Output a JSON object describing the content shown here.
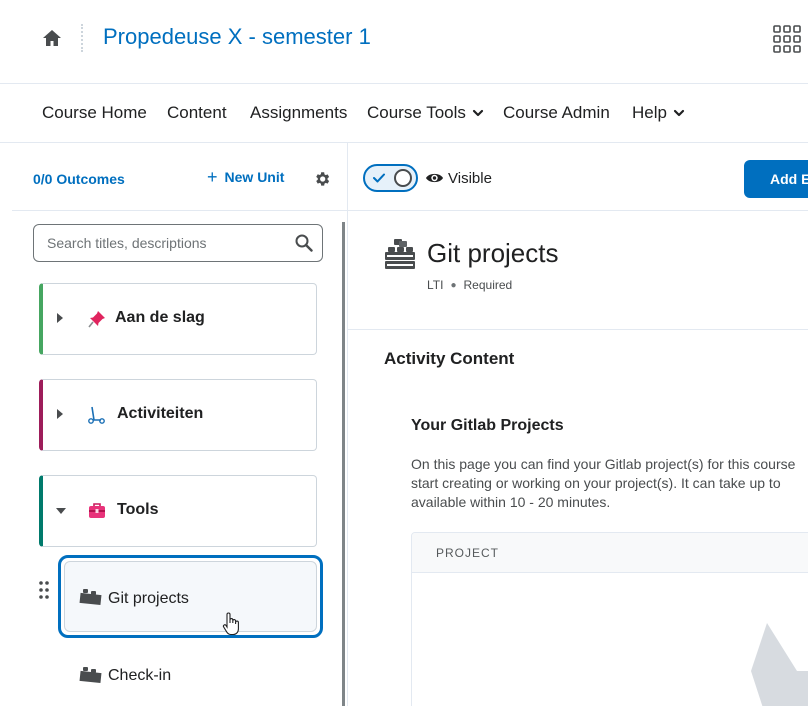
{
  "header": {
    "course_title": "Propedeuse X - semester 1",
    "icons": [
      "home-icon",
      "waffle-icon"
    ]
  },
  "nav": {
    "items": [
      {
        "label": "Course Home",
        "has_menu": false
      },
      {
        "label": "Content",
        "has_menu": false
      },
      {
        "label": "Assignments",
        "has_menu": false
      },
      {
        "label": "Course Tools",
        "has_menu": true
      },
      {
        "label": "Course Admin",
        "has_menu": false
      },
      {
        "label": "Help",
        "has_menu": true
      }
    ]
  },
  "sidebar": {
    "outcomes_link": "0/0 Outcomes",
    "new_unit_label": "New Unit",
    "search_placeholder": "Search titles, descriptions",
    "units": [
      {
        "label": "Aan de slag",
        "icon": "pin-icon",
        "accent": "#46a661",
        "expanded": false
      },
      {
        "label": "Activiteiten",
        "icon": "scooter-icon",
        "accent": "#9d1d5a",
        "expanded": false
      },
      {
        "label": "Tools",
        "icon": "toolbox-icon",
        "accent": "#007a6c",
        "expanded": true
      }
    ],
    "items": [
      {
        "label": "Git projects",
        "icon": "lego-icon",
        "selected": true
      },
      {
        "label": "Check-in",
        "icon": "lego-icon",
        "selected": false
      }
    ]
  },
  "toolbar": {
    "visibility_label": "Visible",
    "visibility_on": true,
    "add_button_label": "Add Existing"
  },
  "activity": {
    "title": "Git projects",
    "type": "LTI",
    "requirement": "Required",
    "section_title": "Activity Content"
  },
  "lti": {
    "title": "Your Gitlab Projects",
    "description_lines": [
      "On this page you can find your Gitlab project(s) for this course",
      "start creating or working on your project(s). It can take up to",
      "available within 10 - 20 minutes."
    ],
    "table_header": "PROJECT"
  },
  "colors": {
    "brand_blue": "#006fbf",
    "text": "#202122"
  }
}
